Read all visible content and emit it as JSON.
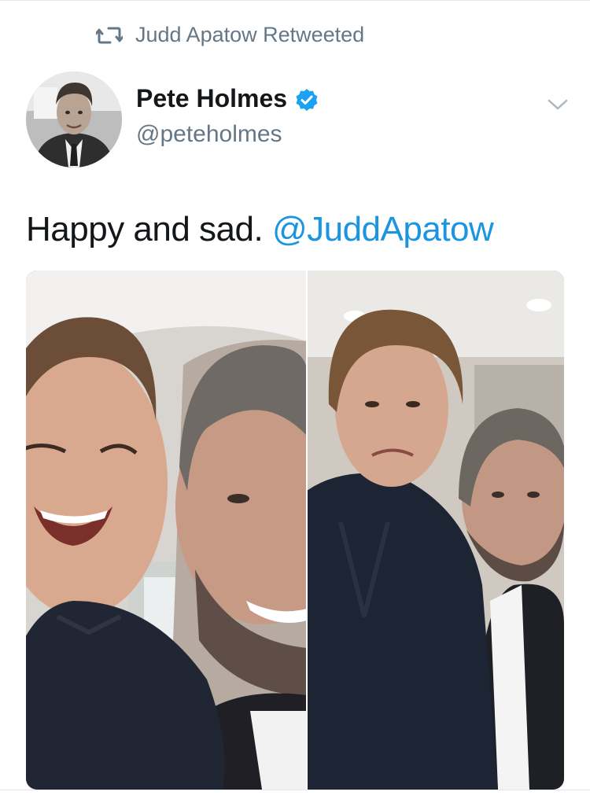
{
  "retweet": {
    "icon": "retweet-icon",
    "label": "Judd Apatow Retweeted"
  },
  "author": {
    "display_name": "Pete Holmes",
    "handle": "@peteholmes",
    "verified_icon": "verified-badge-icon",
    "avatar_icon": "avatar-photo"
  },
  "tweet": {
    "text": "Happy and sad.",
    "mention": "@JuddApatow"
  },
  "menu": {
    "icon": "chevron-down-icon"
  },
  "media": {
    "description_icon": "photo-collage"
  },
  "colors": {
    "link": "#1b95e0",
    "secondary_text": "#657786",
    "primary_text": "#14171a",
    "verified": "#1da1f2"
  }
}
